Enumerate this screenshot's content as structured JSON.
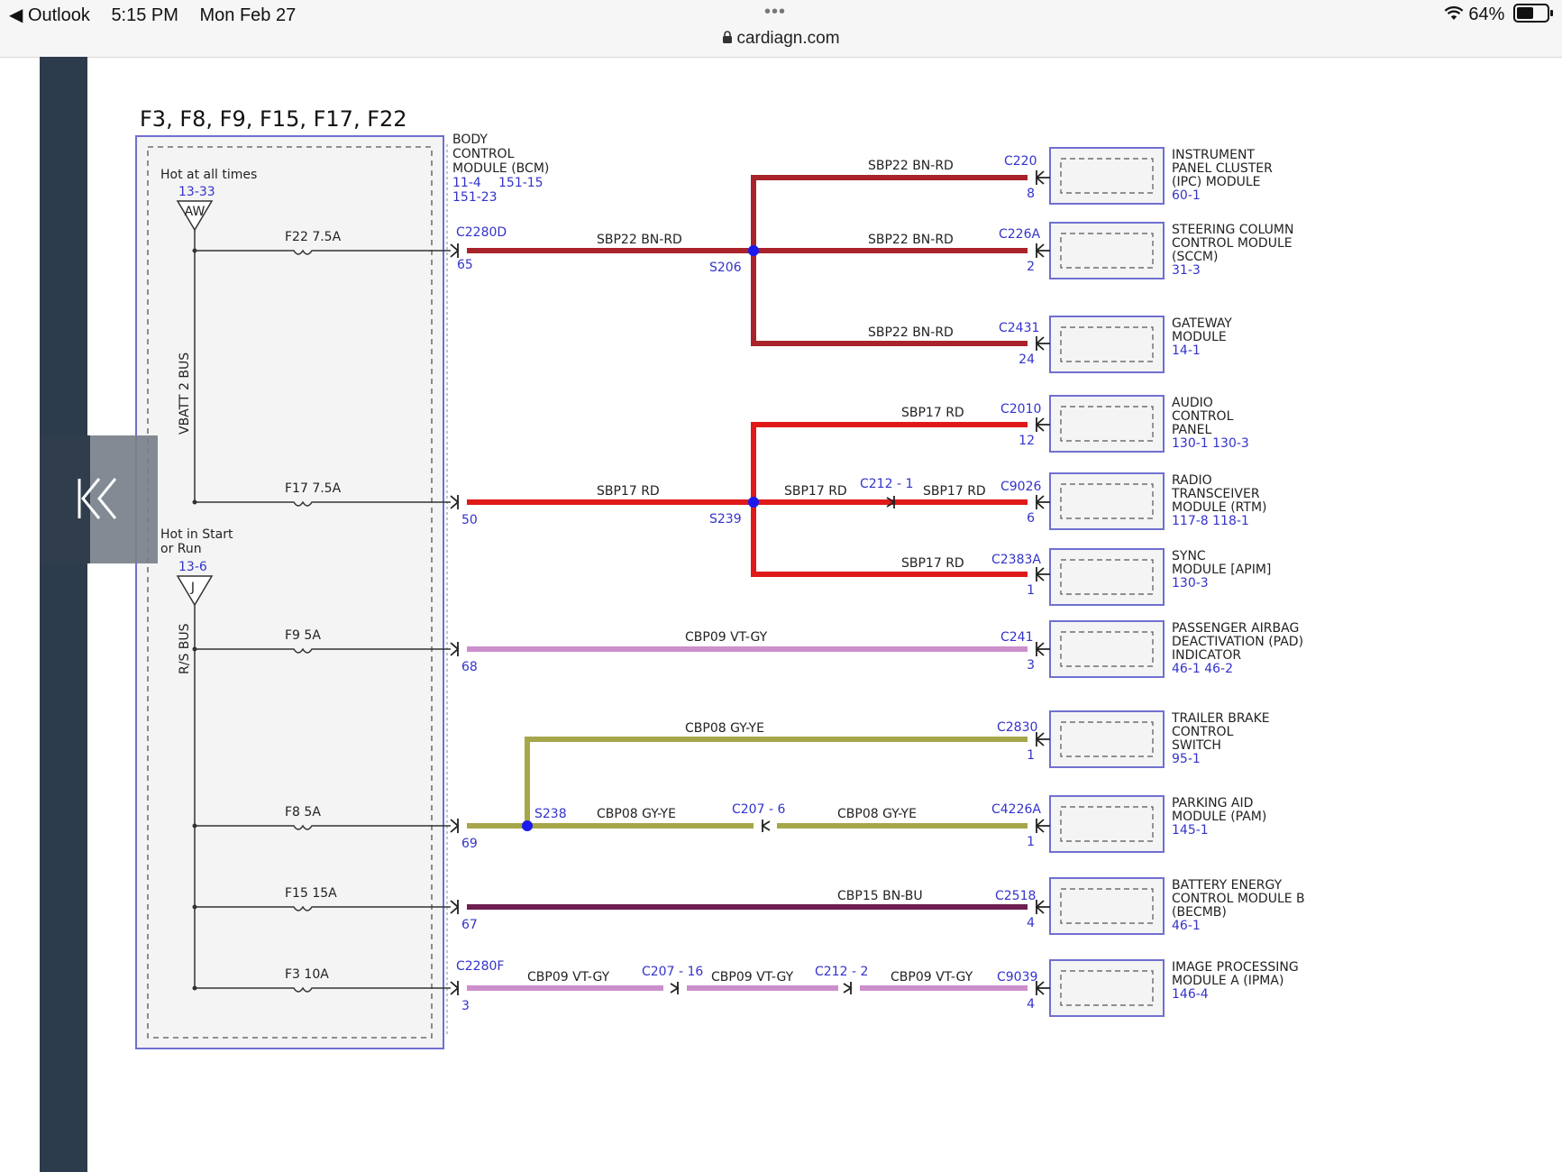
{
  "status_bar": {
    "back_app": "◀ Outlook",
    "time": "5:15 PM",
    "date": "Mon Feb 27",
    "dots": "•••",
    "url": "cardiagn.com",
    "battery": "64%",
    "battery_level": 0.64
  },
  "diagram": {
    "title": "F3, F8, F9, F15, F17, F22",
    "bcm": {
      "name": [
        "BODY",
        "CONTROL",
        "MODULE (BCM)"
      ],
      "refs1": "11-4",
      "refs2": "151-15",
      "refs3": "151-23"
    },
    "hot_all": {
      "label": "Hot at all times",
      "ref": "13-33",
      "tag": "AW"
    },
    "hot_run": {
      "label1": "Hot in Start",
      "label2": "or Run",
      "ref": "13-6",
      "tag": "J"
    },
    "bus1": "VBATT 2 BUS",
    "bus2": "R/S BUS",
    "fuses": {
      "f22": "F22 7.5A",
      "f17": "F17 7.5A",
      "f9": "F9   5A",
      "f8": "F8   5A",
      "f15": "F15 15A",
      "f3": "F3   10A"
    },
    "bcm_connectors": {
      "c2280d": "C2280D",
      "c2280f": "C2280F"
    },
    "pins": {
      "p65": "65",
      "p50": "50",
      "p68": "68",
      "p69": "69",
      "p67": "67",
      "p3": "3"
    },
    "splices": {
      "s206": "S206",
      "s239": "S239",
      "s238": "S238"
    },
    "circuits": {
      "sbp22": "SBP22  BN-RD",
      "sbp17": "SBP17  RD",
      "cbp09": "CBP09  VT-GY",
      "cbp08": "CBP08  GY-YE",
      "cbp15": "CBP15  BN-BU"
    },
    "inline": {
      "c212_1": "C212 - 1",
      "c207_6": "C207 - 6",
      "c207_16": "C207 - 16",
      "c212_2": "C212 - 2"
    },
    "modules": {
      "ipc": {
        "connector": "C220",
        "pin": "8",
        "lines": [
          "INSTRUMENT",
          "PANEL CLUSTER",
          "(IPC) MODULE"
        ],
        "ref": "60-1"
      },
      "sccm": {
        "connector": "C226A",
        "pin": "2",
        "lines": [
          "STEERING COLUMN",
          "CONTROL MODULE",
          "(SCCM)"
        ],
        "ref": "31-3"
      },
      "gateway": {
        "connector": "C2431",
        "pin": "24",
        "lines": [
          "GATEWAY",
          "MODULE"
        ],
        "ref": "14-1"
      },
      "audio": {
        "connector": "C2010",
        "pin": "12",
        "lines": [
          "AUDIO",
          "CONTROL",
          "PANEL"
        ],
        "ref": "130-1 130-3"
      },
      "rtm": {
        "connector": "C9026",
        "pin": "6",
        "lines": [
          "RADIO",
          "TRANSCEIVER",
          "MODULE (RTM)"
        ],
        "ref": "117-8 118-1"
      },
      "sync": {
        "connector": "C2383A",
        "pin": "1",
        "lines": [
          "SYNC",
          "MODULE [APIM]"
        ],
        "ref": "130-3"
      },
      "pad": {
        "connector": "C241",
        "pin": "3",
        "lines": [
          "PASSENGER AIRBAG",
          "DEACTIVATION (PAD)",
          "INDICATOR"
        ],
        "ref": "46-1   46-2"
      },
      "tbc": {
        "connector": "C2830",
        "pin": "1",
        "lines": [
          "TRAILER BRAKE",
          "CONTROL",
          "SWITCH"
        ],
        "ref": "95-1"
      },
      "pam": {
        "connector": "C4226A",
        "pin": "1",
        "lines": [
          "PARKING AID",
          "MODULE (PAM)"
        ],
        "ref": "145-1"
      },
      "becmb": {
        "connector": "C2518",
        "pin": "4",
        "lines": [
          "BATTERY ENERGY",
          "CONTROL MODULE B",
          "(BECMB)"
        ],
        "ref": "46-1"
      },
      "ipma": {
        "connector": "C9039",
        "pin": "4",
        "lines": [
          "IMAGE PROCESSING",
          "MODULE A (IPMA)"
        ],
        "ref": "146-4"
      }
    },
    "colors": {
      "bn_rd": "#a8232a",
      "rd": "#e01919",
      "vt_gy": "#cc8fcc",
      "gy_ye": "#a6a64a",
      "bn_bu": "#6e1f52",
      "link": "#3333cc",
      "splice": "#1a1aee"
    }
  }
}
